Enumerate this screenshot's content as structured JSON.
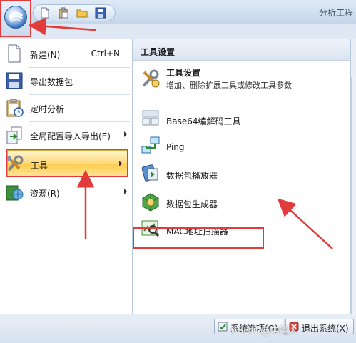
{
  "window": {
    "app_title": "分析工程",
    "orb_icon": "app-orb-icon",
    "quick_access": [
      {
        "icon": "new-file-icon"
      },
      {
        "icon": "paste-icon"
      },
      {
        "icon": "open-folder-icon"
      },
      {
        "icon": "save-icon"
      }
    ]
  },
  "left_menu": {
    "items": [
      {
        "label": "新建(N)",
        "shortcut": "Ctrl+N",
        "icon": "new-document-icon"
      },
      {
        "label": "导出数据包",
        "icon": "save-disk-icon"
      },
      {
        "label": "定时分析",
        "icon": "clipboard-clock-icon"
      },
      {
        "label": "全局配置导入导出(E)",
        "icon": "import-export-icon",
        "has_submenu": true
      },
      {
        "label": "工具",
        "icon": "tools-icon",
        "has_submenu": true,
        "selected": true
      },
      {
        "label": "资源(R)",
        "icon": "book-globe-icon",
        "has_submenu": true
      }
    ]
  },
  "tools_panel": {
    "header": "工具设置",
    "items": [
      {
        "label": "工具设置",
        "description": "增加、删除扩展工具或修改工具参数",
        "icon": "tool-settings-icon"
      },
      {
        "label": "Base64编解码工具",
        "icon": "base64-codec-icon"
      },
      {
        "label": "Ping",
        "icon": "ping-network-icon"
      },
      {
        "label": "数据包播放器",
        "icon": "packet-player-icon"
      },
      {
        "label": "数据包生成器",
        "icon": "packet-generator-icon"
      },
      {
        "label": "MAC地址扫描器",
        "icon": "mac-scanner-icon"
      }
    ]
  },
  "footer": {
    "options_button": "系统选项(O)",
    "exit_button": "退出系统(X)"
  },
  "watermark": "CSDN @中经人",
  "annotation_colors": {
    "highlight": "#e23b3b",
    "menu_hover": "#ffd879"
  }
}
